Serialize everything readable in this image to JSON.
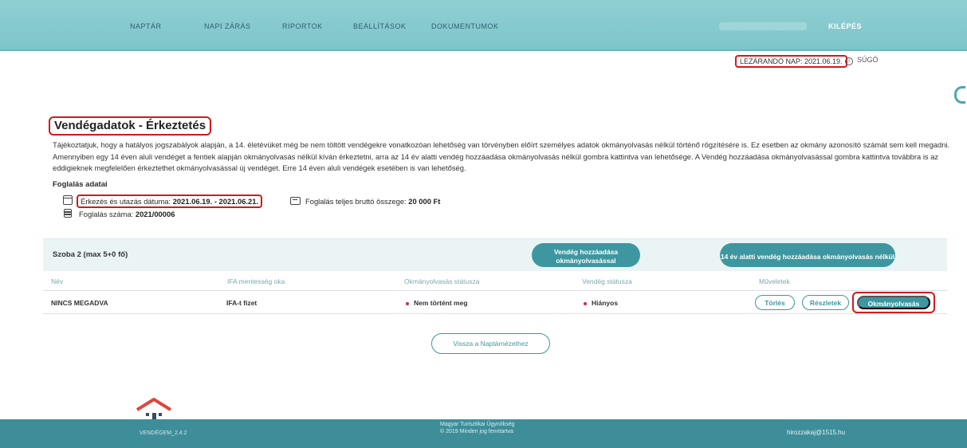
{
  "nav": {
    "items": [
      "NAPTÁR",
      "NAPI ZÁRÁS",
      "RIPORTOK",
      "BEÁLLÍTÁSOK",
      "DOKUMENTUMOK"
    ],
    "logout": "KILÉPÉS"
  },
  "header": {
    "closing_day": "LEZÁRANDÓ NAP: 2021.06.19.",
    "help": "SÚGÓ"
  },
  "page": {
    "title": "Vendégadatok - Érkeztetés",
    "intro": "Tájékoztatjuk, hogy a hatályos jogszabályok alapján, a 14. életévüket még be nem töltött vendégekre vonatkozóan lehetőség van törvényben előírt személyes adatok okmányolvasás nélkül történő rögzítésére is. Ez esetben az okmány azonosító számát sem kell megadni. Amennyiben egy 14 éven aluli vendéget a fentiek alapján okmányolvasás nélkül kíván érkeztetni, arra az 14 év alatti vendég hozzáadása okmányolvasás nélkül gombra kattintva van lehetősége. A Vendég hozzáadása okmányolvasással gombra kattintva továbbra is az eddigieknek megfelelően érkeztethet okmányolvasással új vendéget. Erre 14 éven aluli vendégek esetében is van lehetőség."
  },
  "booking": {
    "section": "Foglalás adatai",
    "dates_label": "Érkezés és utazás dátuma: ",
    "dates_value": "2021.06.19. - 2021.06.21.",
    "total_label": "Foglalás teljes bruttó összege: ",
    "total_value": "20 000 Ft",
    "number_label": "Foglalás száma: ",
    "number_value": "2021/00006"
  },
  "room": {
    "name": "Szoba 2 (max 5+0 fő)",
    "add_with_doc": "Vendég hozzáadása okmányolvasással",
    "add_under14": "14 év alatti vendég hozzáadása okmányolvasás nélkül",
    "columns": [
      "Név",
      "IFA mentesség oka",
      "Okmányolvasás státusza",
      "Vendég státusza",
      "Műveletek"
    ],
    "row": {
      "name": "NINCS MEGADVA",
      "ifa": "IFA-t fizet",
      "doc_status": "Nem történt meg",
      "guest_status": "Hiányos",
      "delete": "Törlés",
      "details": "Részletek",
      "doc_read": "Okmányolvasás"
    }
  },
  "back_button": "Vissza a Naptárnézethez",
  "footer": {
    "version": "VENDÉGEM_2.4.2",
    "line1": "Magyar Turisztikai Ügynökség",
    "line2": "© 2019 Minden jog fenntartva",
    "email": "hirozzakaj@1515.hu"
  },
  "colors": {
    "accent": "#3e97a0",
    "topbar": "#86cacd",
    "highlight": "#d01b1b"
  }
}
